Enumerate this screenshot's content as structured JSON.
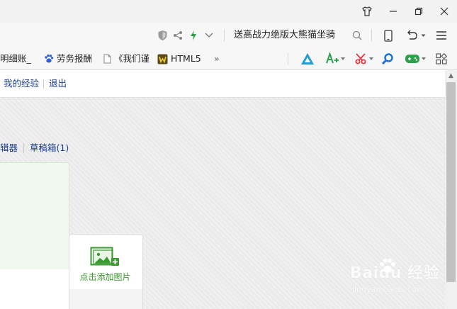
{
  "window": {
    "skin_icon": "tshirt-icon",
    "minimize_icon": "minimize-icon",
    "restore_icon": "restore-icon",
    "close_icon": "close-icon"
  },
  "toolbar": {
    "search_text": "送高战力绝版大熊猫坐骑"
  },
  "bookmarks": [
    {
      "label": "明细账_",
      "icon": "none"
    },
    {
      "label": "劳务报酬",
      "icon": "paw-icon"
    },
    {
      "label": "《我们谨",
      "icon": "page-icon"
    },
    {
      "label": "HTML5",
      "icon": "html5-icon"
    },
    {
      "label": "»",
      "icon": "none"
    }
  ],
  "user_links": {
    "my_experience": "我的经验",
    "logout": "退出"
  },
  "tabs": {
    "editor": "辑器",
    "drafts": "草稿箱(1)"
  },
  "upload": {
    "label": "点击添加图片",
    "icon": "add-image-icon"
  },
  "watermark": {
    "logo": "Baidu 经验",
    "url": "jingyan.baidu.com"
  },
  "colors": {
    "link": "#1a3d8f",
    "accent_green": "#3a9a2e"
  }
}
